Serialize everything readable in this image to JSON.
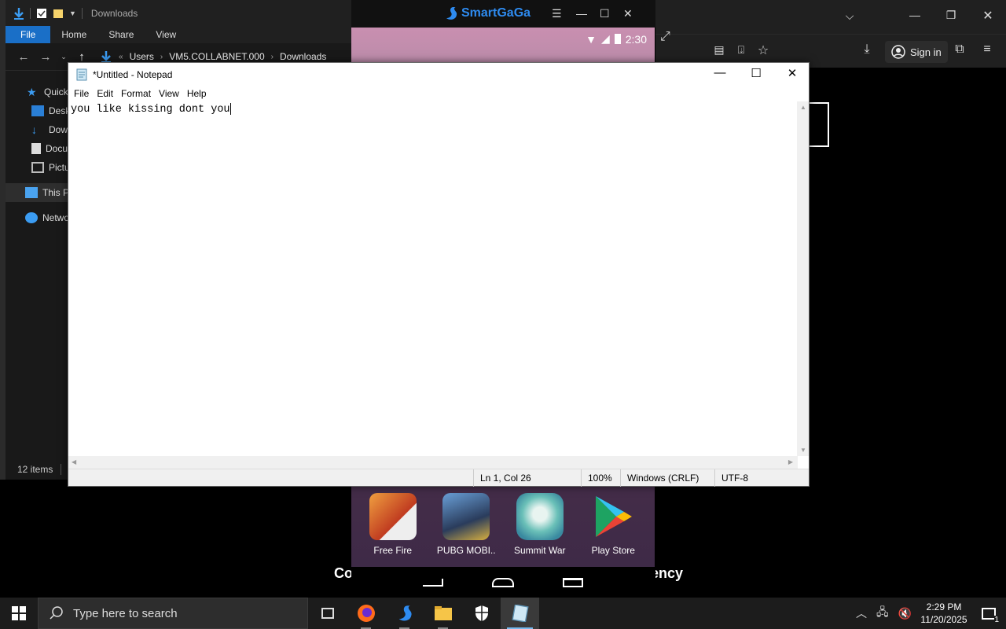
{
  "explorer": {
    "title": "Downloads",
    "ribbon_tabs": [
      "File",
      "Home",
      "Share",
      "View"
    ],
    "breadcrumb": [
      "Users",
      "VM5.COLLABNET.000",
      "Downloads"
    ],
    "nav_items": [
      "Quick access",
      "Desktop",
      "Downloads",
      "Documents",
      "Pictures",
      "This PC",
      "Network"
    ],
    "status_count": "12 items"
  },
  "emulator": {
    "brand": "SmartGaGa",
    "time": "2:30",
    "apps": [
      {
        "label": "Free Fire",
        "icon": "free-fire-app-icon"
      },
      {
        "label": "PUBG MOBI..",
        "icon": "pubg-mobile-app-icon"
      },
      {
        "label": "Summit War",
        "icon": "summit-war-app-icon"
      },
      {
        "label": "Play Store",
        "icon": "play-store-app-icon"
      }
    ]
  },
  "browser": {
    "sign_in": "Sign in"
  },
  "background_text": {
    "left": "Co",
    "right": "ency"
  },
  "notepad": {
    "title": "*Untitled - Notepad",
    "menu": [
      "File",
      "Edit",
      "Format",
      "View",
      "Help"
    ],
    "content": "you like kissing dont you",
    "status": {
      "position": "Ln 1, Col 26",
      "zoom": "100%",
      "line_ending": "Windows (CRLF)",
      "encoding": "UTF-8"
    }
  },
  "taskbar": {
    "search_placeholder": "Type here to search",
    "time": "2:29 PM",
    "date": "11/20/2025",
    "notification_count": "1"
  },
  "colors": {
    "explorer_file_tab": "#1a6fc7",
    "smartgaga_blue": "#2e8bf0",
    "taskbar_active": "#76b9ed"
  }
}
